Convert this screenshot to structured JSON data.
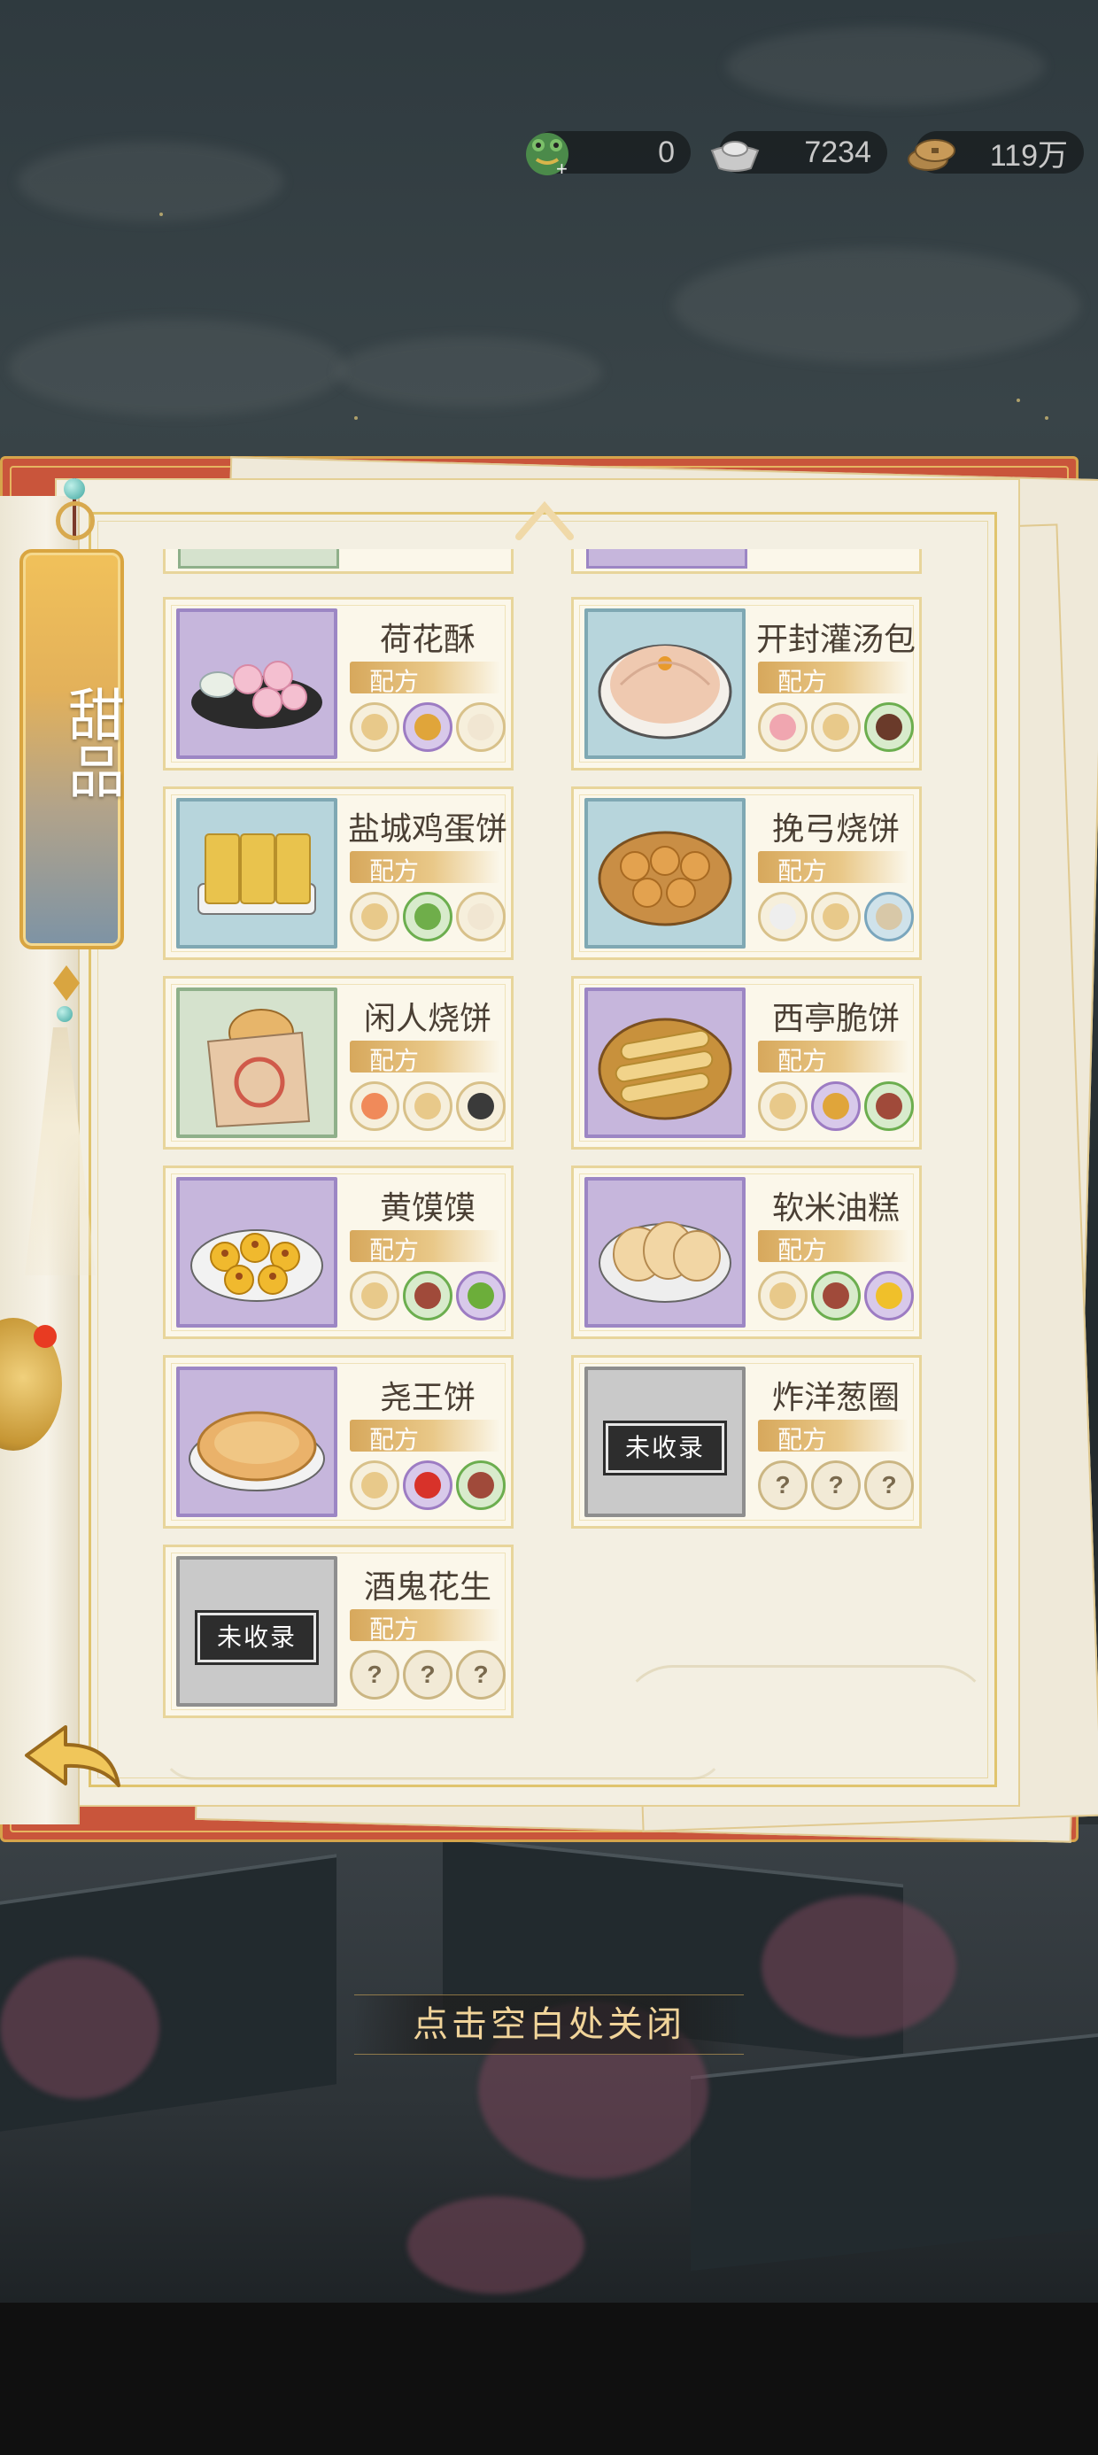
{
  "currencies": [
    {
      "icon": "jade-frog-icon",
      "value": "0"
    },
    {
      "icon": "silver-ingot-icon",
      "value": "7234"
    },
    {
      "icon": "copper-coins-icon",
      "value": "119万"
    }
  ],
  "category": {
    "title": "甜品"
  },
  "recipe_tag_label": "配方",
  "recipes": [
    {
      "name": "荷花酥",
      "status": "collected",
      "thumb_color": "purple",
      "food": "lotus-pastry",
      "ingredients": [
        "flour",
        "honey",
        "egg"
      ]
    },
    {
      "name": "开封灌汤包",
      "status": "collected",
      "thumb_color": "blue",
      "food": "soup-dumpling",
      "ingredients": [
        "meat",
        "flour",
        "soy-sauce"
      ]
    },
    {
      "name": "盐城鸡蛋饼",
      "status": "collected",
      "thumb_color": "blue",
      "food": "egg-pancake",
      "ingredients": [
        "flour",
        "scallion",
        "egg"
      ]
    },
    {
      "name": "挽弓烧饼",
      "status": "collected",
      "thumb_color": "blue",
      "food": "sesame-cakes",
      "ingredients": [
        "garlic",
        "flour",
        "mushroom"
      ]
    },
    {
      "name": "闲人烧饼",
      "status": "collected",
      "thumb_color": "green",
      "food": "bagged-shaobing",
      "ingredients": [
        "salmon",
        "flour",
        "sesame"
      ]
    },
    {
      "name": "西亭脆饼",
      "status": "collected",
      "thumb_color": "purple",
      "food": "crispy-rolls",
      "ingredients": [
        "flour",
        "honey",
        "sugar"
      ]
    },
    {
      "name": "黄馍馍",
      "status": "collected",
      "thumb_color": "purple",
      "food": "yellow-buns",
      "ingredients": [
        "flour",
        "sugar",
        "beans"
      ]
    },
    {
      "name": "软米油糕",
      "status": "collected",
      "thumb_color": "purple",
      "food": "oil-cakes",
      "ingredients": [
        "flour",
        "sugar",
        "osmanthus"
      ]
    },
    {
      "name": "尧王饼",
      "status": "collected",
      "thumb_color": "purple",
      "food": "round-pie",
      "ingredients": [
        "flour",
        "chili",
        "sugar"
      ]
    },
    {
      "name": "炸洋葱圈",
      "status": "unrecorded",
      "thumb_color": "gray",
      "food": "",
      "ingredients": [
        "?",
        "?",
        "?"
      ]
    },
    {
      "name": "酒鬼花生",
      "status": "unrecorded",
      "thumb_color": "gray",
      "food": "",
      "ingredients": [
        "?",
        "?",
        "?"
      ]
    }
  ],
  "unrecorded_label": "未收录",
  "unknown_ingredient": "?",
  "close_hint": "点击空白处关闭",
  "colors": {
    "book_cover": "#c9553b",
    "page": "#f3efe2",
    "gold_trim": "#e0c46e",
    "tag_gold": "#f1c15a",
    "tag_blue": "#7d93a5"
  }
}
